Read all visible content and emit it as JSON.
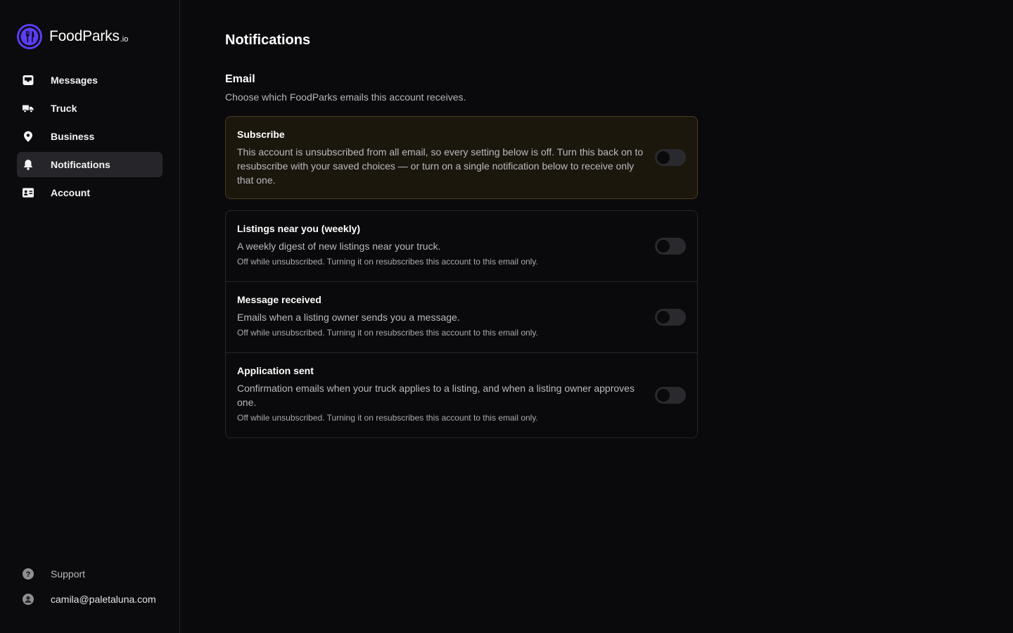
{
  "brand": {
    "name": "FoodParks",
    "suffix": ".io",
    "accent": "#5b3df5"
  },
  "sidebar": {
    "items": [
      {
        "label": "Messages",
        "icon": "inbox-icon",
        "active": false
      },
      {
        "label": "Truck",
        "icon": "truck-icon",
        "active": false
      },
      {
        "label": "Business",
        "icon": "map-pin-icon",
        "active": false
      },
      {
        "label": "Notifications",
        "icon": "bell-icon",
        "active": true
      },
      {
        "label": "Account",
        "icon": "id-card-icon",
        "active": false
      }
    ],
    "footer": {
      "support_label": "Support",
      "user_email": "camila@paletaluna.com"
    }
  },
  "page": {
    "title": "Notifications",
    "section_title": "Email",
    "section_desc": "Choose which FoodParks emails this account receives."
  },
  "subscribe": {
    "title": "Subscribe",
    "body": "This account is unsubscribed from all email, so every setting below is off. Turn this back on to resubscribe with your saved choices — or turn on a single notification below to receive only that one.",
    "enabled": false
  },
  "settings": [
    {
      "title": "Listings near you (weekly)",
      "desc": "A weekly digest of new listings near your truck.",
      "note": "Off while unsubscribed. Turning it on resubscribes this account to this email only.",
      "enabled": false
    },
    {
      "title": "Message received",
      "desc": "Emails when a listing owner sends you a message.",
      "note": "Off while unsubscribed. Turning it on resubscribes this account to this email only.",
      "enabled": false
    },
    {
      "title": "Application sent",
      "desc": "Confirmation emails when your truck applies to a listing, and when a listing owner approves one.",
      "note": "Off while unsubscribed. Turning it on resubscribes this account to this email only.",
      "enabled": false
    }
  ]
}
